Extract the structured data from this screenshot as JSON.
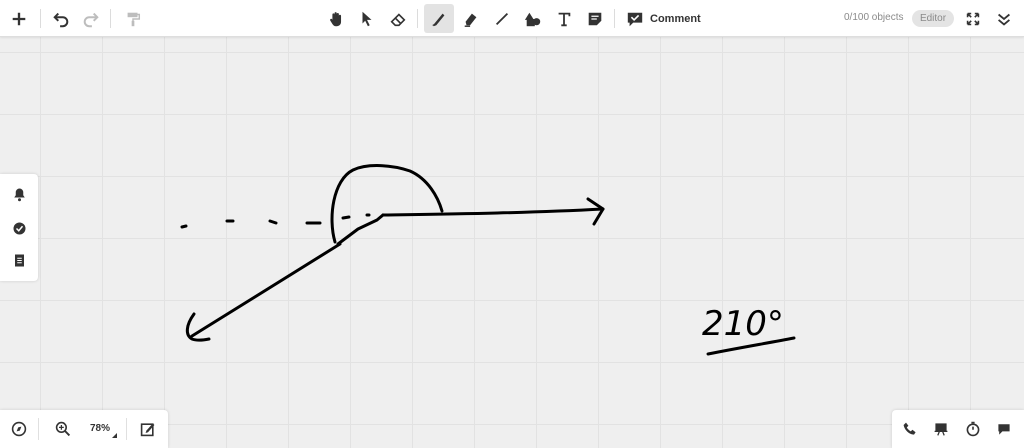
{
  "toolbar": {
    "buttons": {
      "add": "add-icon",
      "undo": "undo-icon",
      "redo": "redo-icon",
      "format_painter": "format-painter-icon",
      "hand": "hand-icon",
      "select": "pointer-icon",
      "eraser": "eraser-icon",
      "pen": "pen-icon",
      "highlighter": "highlighter-icon",
      "line": "line-icon",
      "shapes": "shapes-icon",
      "text": "text-icon",
      "sticky_note": "sticky-note-icon",
      "fullscreen": "fullscreen-icon",
      "collapse": "collapse-icon"
    },
    "comment_label": "Comment",
    "object_count": "0/100 objects",
    "editor_label": "Editor",
    "active_tool": "pen"
  },
  "side_panel": {
    "items": [
      "bell-icon",
      "check-circle-icon",
      "list-icon"
    ]
  },
  "bottom_left": {
    "zoom": "78%",
    "items": [
      "compass-icon",
      "zoom-icon",
      "edit-icon"
    ]
  },
  "bottom_right": {
    "items": [
      "phone-icon",
      "present-icon",
      "timer-icon",
      "chat-icon"
    ]
  },
  "canvas": {
    "annotation": "210°",
    "ink_color": "#000000",
    "grid_color": "#e2e2e2",
    "background_color": "#efefef"
  }
}
